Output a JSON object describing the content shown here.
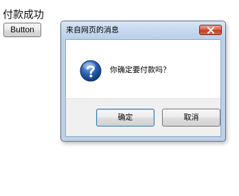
{
  "page": {
    "heading": "付款成功",
    "button_label": "Button"
  },
  "dialog": {
    "title": "来自网页的消息",
    "message": "你确定要付款吗？",
    "icon": "question-icon",
    "close_icon": "close-icon",
    "ok_label": "确定",
    "cancel_label": "取消"
  },
  "colors": {
    "title_bar": "#c7d9ef",
    "close_button": "#c23e22",
    "question_icon": "#2a5fb0",
    "button_area": "#f0f0f0",
    "default_button_border": "#3c7fb1"
  }
}
